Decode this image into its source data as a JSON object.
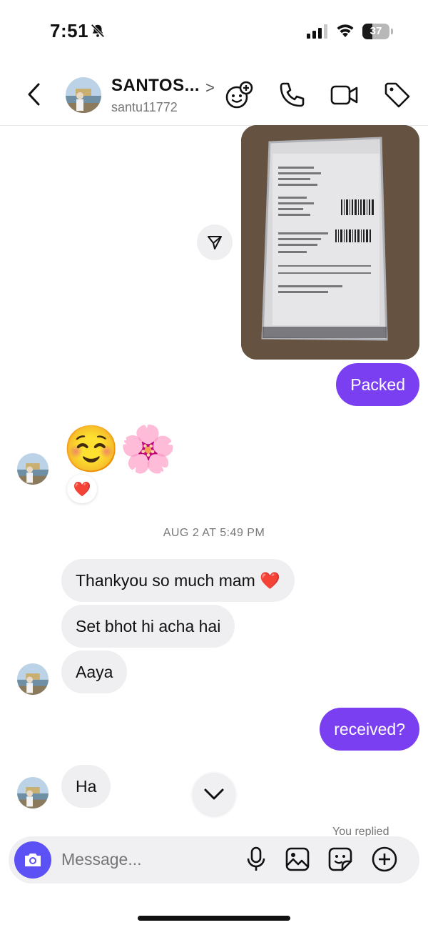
{
  "status_bar": {
    "time": "7:51",
    "battery": "37",
    "battery_level_percent": 37
  },
  "header": {
    "name": "SANTOS...",
    "chevron": ">",
    "username": "santu11772"
  },
  "messages": {
    "sent_caption": "Packed",
    "reaction_emojis": "☺️🌸",
    "reaction_badge": "❤️",
    "date_separator": "AUG 2 AT 5:49 PM",
    "incoming_1": "Thankyou  so much mam ❤️",
    "incoming_2": "Set bhot hi acha hai",
    "incoming_3": "Aaya",
    "outgoing_received": "received?",
    "incoming_4": "Ha",
    "you_replied": "You replied"
  },
  "composer": {
    "placeholder": "Message..."
  },
  "colors": {
    "accent_purple": "#7b3ff2",
    "camera_blue": "#5b51f5",
    "bubble_gray": "#efeff2"
  },
  "icons": [
    "bell-muted-icon",
    "signal-icon",
    "wifi-icon",
    "battery-icon",
    "back-chevron-icon",
    "add-people-icon",
    "phone-icon",
    "video-icon",
    "tag-icon",
    "share-send-icon",
    "chevron-down-icon",
    "camera-icon",
    "microphone-icon",
    "gallery-icon",
    "sticker-icon",
    "plus-icon"
  ]
}
